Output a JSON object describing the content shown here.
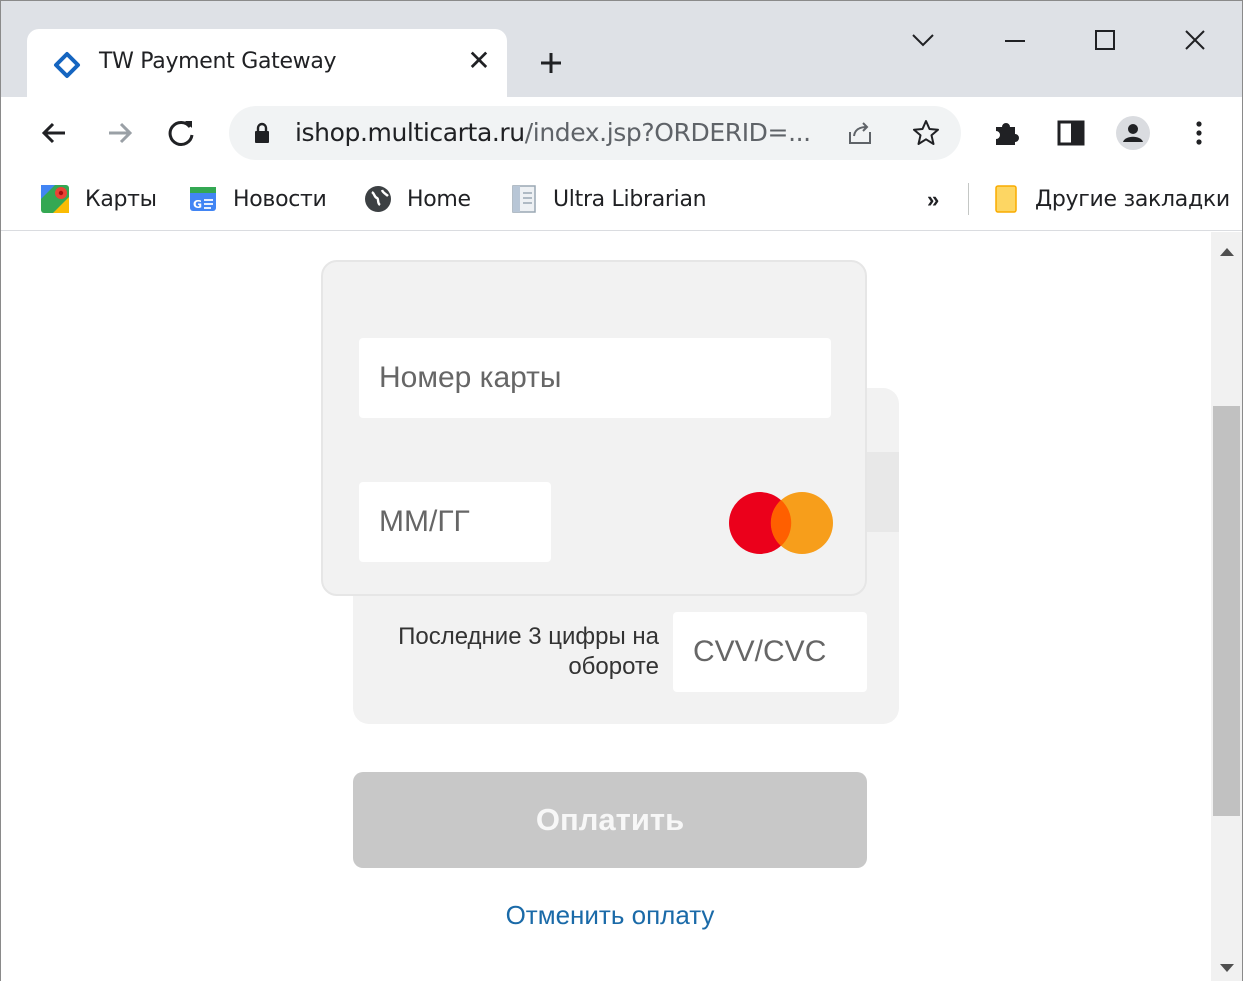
{
  "tab": {
    "title": "TW Payment Gateway",
    "close_glyph": "✕",
    "favicon": "tw-gateway-icon"
  },
  "address_bar": {
    "host": "ishop.multicarta.ru",
    "path": "/index.jsp?ORDERID=..."
  },
  "bookmarks": {
    "items": [
      {
        "label": "Карты",
        "icon": "maps-icon"
      },
      {
        "label": "Новости",
        "icon": "news-icon"
      },
      {
        "label": "Home",
        "icon": "globe-icon"
      },
      {
        "label": "Ultra Librarian",
        "icon": "document-icon"
      }
    ],
    "overflow": "»",
    "other_bookmarks": "Другие закладки"
  },
  "payment_form": {
    "card_number_placeholder": "Номер карты",
    "expiry_placeholder": "ММ/ГГ",
    "cvv_hint": "Последние 3 цифры на обороте",
    "cvv_placeholder": "CVV/CVC",
    "pay_label": "Оплатить",
    "cancel_label": "Отменить оплату",
    "card_brand": "mastercard"
  },
  "colors": {
    "mastercard_red": "#eb001b",
    "mastercard_orange": "#f79e1b",
    "mastercard_overlap": "#ff5f00",
    "pay_button_disabled": "#c8c8c8",
    "cancel_link": "#1a6aa8"
  }
}
